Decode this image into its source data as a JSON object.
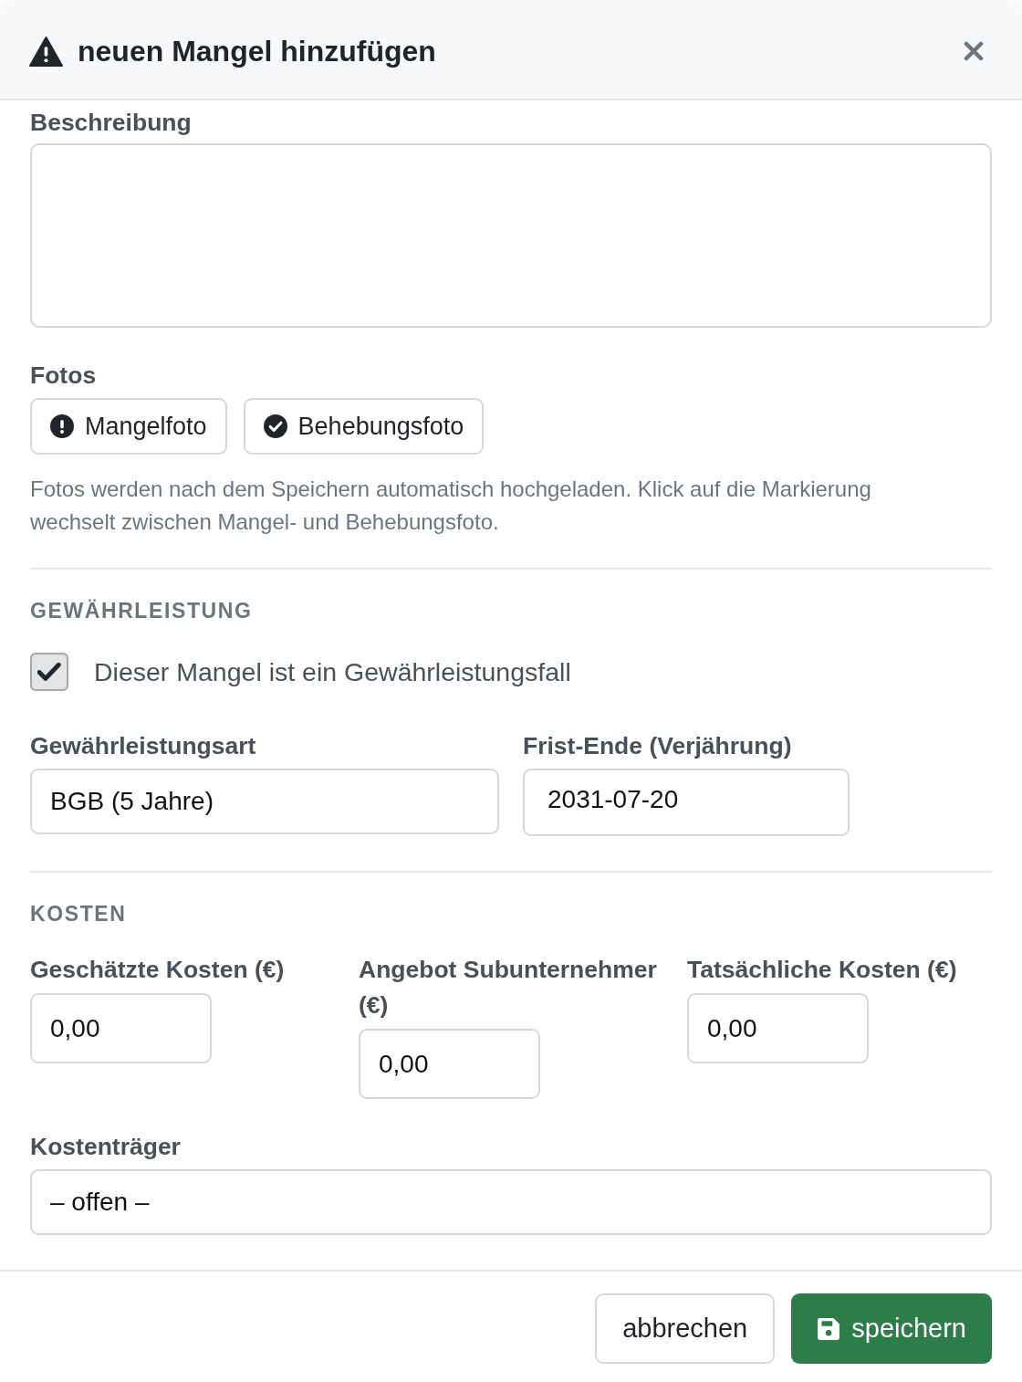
{
  "dialog": {
    "title": "neuen Mangel hinzufügen"
  },
  "description": {
    "label": "Beschreibung"
  },
  "photos": {
    "label": "Fotos",
    "buttons": [
      {
        "label": "Mangelfoto",
        "kind": "defect"
      },
      {
        "label": "Behebungsfoto",
        "kind": "fixed"
      }
    ],
    "hint": "Fotos werden nach dem Speichern automatisch hochgeladen. Klick auf die Markierung wechselt zwischen Mangel- und Behebungsfoto."
  },
  "warranty": {
    "heading": "GEWÄHRLEISTUNG",
    "checkbox": {
      "label": "Dieser Mangel ist ein Gewährleistungsfall",
      "checked": true
    },
    "fields": [
      {
        "label": "Gewährleistungsart",
        "value": "BGB (5 Jahre)"
      },
      {
        "label": "Frist-Ende (Verjährung)",
        "value": "2031-07-20"
      }
    ]
  },
  "costs": {
    "heading": "KOSTEN",
    "fields": [
      {
        "label": "Geschätzte Kosten (€)",
        "value": "0,00"
      },
      {
        "label": "Angebot Subunternehmer (€)",
        "value": "0,00"
      },
      {
        "label": "Tatsächliche Kosten (€)",
        "value": "0,00"
      }
    ],
    "payer": {
      "label": "Kostenträger",
      "value": "– offen –"
    }
  },
  "footer": {
    "buttons": [
      {
        "label": "abbrechen",
        "kind": "secondary"
      },
      {
        "label": "speichern",
        "kind": "primary"
      }
    ]
  }
}
